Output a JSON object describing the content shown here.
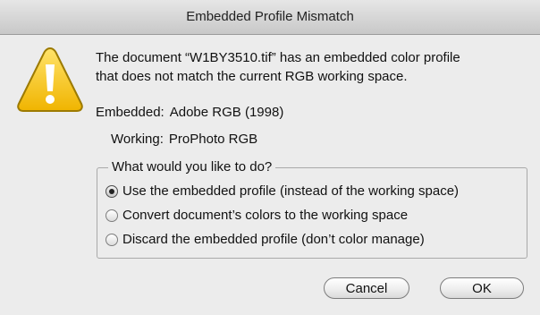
{
  "window": {
    "title": "Embedded Profile Mismatch"
  },
  "icon": {
    "name": "warning-icon",
    "color": "#f2c21b"
  },
  "message": {
    "line1": "The document “W1BY3510.tif” has an embedded color profile",
    "line2": "that does not match the current RGB working space."
  },
  "profiles": {
    "embedded_label": "Embedded:",
    "embedded_value": "Adobe RGB (1998)",
    "working_label": "Working:",
    "working_value": "ProPhoto RGB"
  },
  "choice": {
    "legend": "What would you like to do?",
    "options": [
      {
        "label": "Use the embedded profile (instead of the working space)",
        "selected": true
      },
      {
        "label": "Convert document’s colors to the working space",
        "selected": false
      },
      {
        "label": "Discard the embedded profile (don’t color manage)",
        "selected": false
      }
    ]
  },
  "buttons": {
    "cancel_label": "Cancel",
    "ok_label": "OK"
  }
}
